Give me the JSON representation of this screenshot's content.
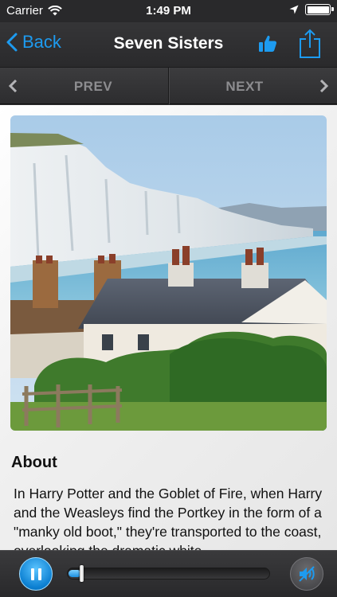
{
  "status_bar": {
    "carrier": "Carrier",
    "time": "1:49 PM",
    "battery_level": 1.0,
    "icons": [
      "wifi-icon",
      "location-arrow-icon",
      "battery-icon"
    ]
  },
  "nav": {
    "back_label": "Back",
    "title": "Seven Sisters",
    "accent_color": "#1d9bf0",
    "icons": [
      "chevron-left-icon",
      "thumbs-up-icon",
      "share-icon"
    ]
  },
  "pager": {
    "prev_label": "PREV",
    "next_label": "NEXT"
  },
  "content": {
    "image_subject": "white chalk cliffs above the sea with coastguard cottages in the foreground",
    "about_heading": "About",
    "about_text": "In Harry Potter and the Goblet of Fire, when Harry and the Weasleys find the Portkey in the form of a \"manky old boot,\" they're transported to the coast, overlooking the dramatic white"
  },
  "player": {
    "state": "playing",
    "progress": 0.065,
    "muted": true,
    "icons": [
      "pause-icon",
      "speaker-muted-icon"
    ]
  }
}
